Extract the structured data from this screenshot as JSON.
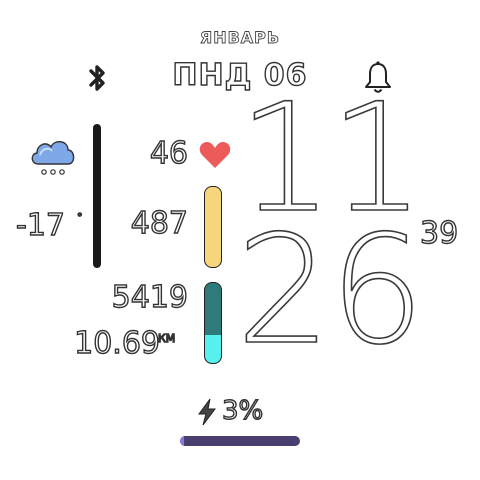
{
  "header": {
    "month": "ЯНВАРЬ",
    "date": "ПНД 06"
  },
  "status_icons": {
    "left": "bluetooth-icon",
    "right": "bell-icon"
  },
  "weather": {
    "icon": "snow-cloud-icon",
    "temperature": "-17",
    "unit": "°"
  },
  "heart_rate": {
    "value": "46",
    "icon": "heart-icon"
  },
  "calories": {
    "value": "487",
    "bar_fill": 1.0
  },
  "activity": {
    "value": "5419",
    "distance": "10.69",
    "distance_unit": "КМ",
    "bar_fill": 0.35
  },
  "time": {
    "hour": "11",
    "minute": "26",
    "seconds": "39"
  },
  "battery": {
    "value": "3%",
    "icon": "bolt-icon",
    "level": 0.03
  },
  "colors": {
    "heart": "#ec5a5a",
    "calories_bar": "#f6d57c",
    "activity_bar_bg": "#2f7a7a",
    "activity_bar_fill": "#56f1ef",
    "battery_bar_bg": "#4a3e6e",
    "battery_bar_fill": "#8d78d8",
    "weather_cloud": "#7fa8e8"
  }
}
